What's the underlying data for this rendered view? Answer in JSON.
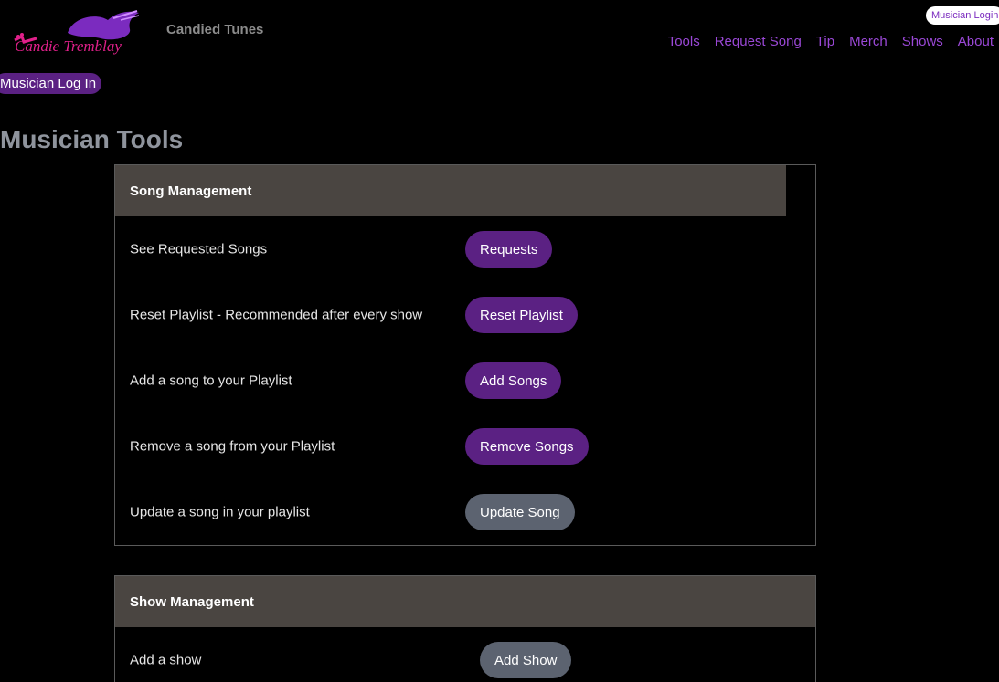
{
  "brand": {
    "logo_text": "Candie Tremblay",
    "site_name": "Candied Tunes"
  },
  "header": {
    "login_pill": "Musician Login",
    "nav": [
      "Tools",
      "Request Song",
      "Tip",
      "Merch",
      "Shows",
      "About"
    ]
  },
  "musician_log_in": "Musician Log In",
  "page_title": "Musician Tools",
  "song_management": {
    "title": "Song Management",
    "rows": [
      {
        "label": "See Requested Songs",
        "button": "Requests"
      },
      {
        "label": "Reset Playlist - Recommended after every show",
        "button": "Reset Playlist"
      },
      {
        "label": "Add a song to your Playlist",
        "button": "Add Songs"
      },
      {
        "label": "Remove a song from your Playlist",
        "button": "Remove Songs"
      },
      {
        "label": "Update a song in your playlist",
        "button": "Update Song"
      }
    ]
  },
  "show_management": {
    "title": "Show Management",
    "rows": [
      {
        "label": "Add a show",
        "button": "Add Show"
      }
    ]
  },
  "colors": {
    "nav_link": "#9a48d6",
    "button_purple": "#5b2183",
    "button_gray": "#5c6370",
    "card_header": "#4a4541",
    "logo_magenta": "#e0208a",
    "logo_purple": "#7b2bbf"
  }
}
